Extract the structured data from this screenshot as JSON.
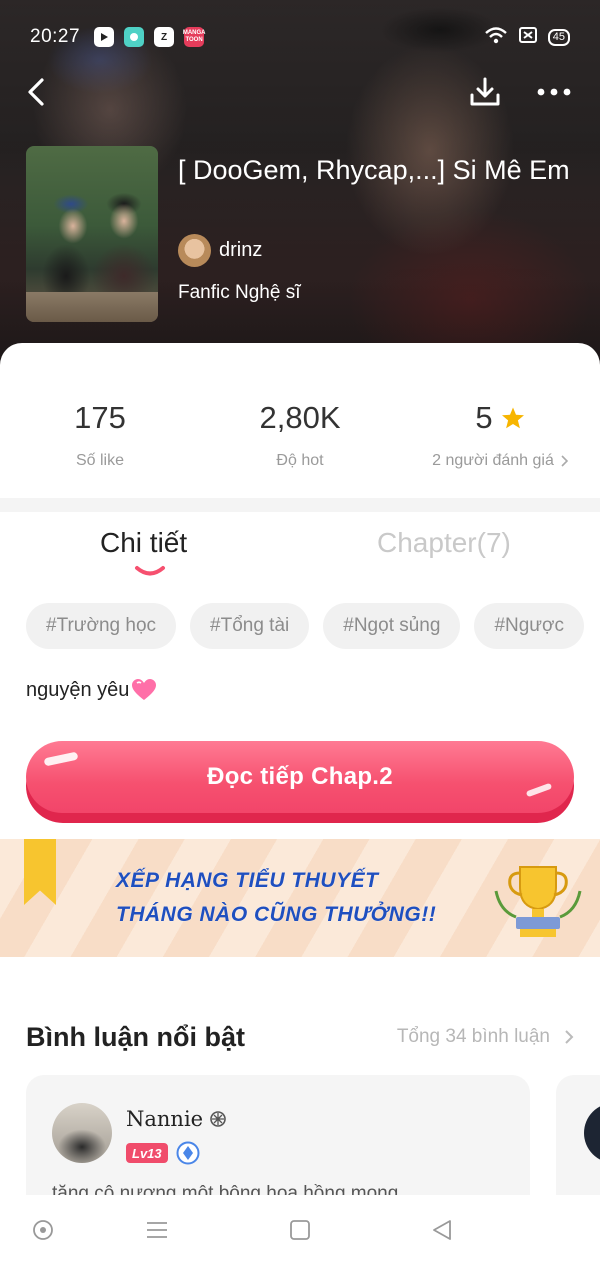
{
  "status_bar": {
    "time": "20:27",
    "apps": [
      "video-app",
      "chat-app",
      "zalo-app",
      "mangatoon-app"
    ],
    "manga_label": "MANGA TOON",
    "zalo_label": "Z",
    "battery": "45"
  },
  "header": {
    "back_icon": "chevron-left-icon",
    "download_icon": "download-icon",
    "more_icon": "more-dots-icon"
  },
  "book": {
    "title": "[ DooGem, Rhycap,...] Si Mê Em",
    "author": "drinz",
    "genre": "Fanfic Nghệ sĩ"
  },
  "stats": {
    "likes_value": "175",
    "likes_label": "Số like",
    "hot_value": "2,80K",
    "hot_label": "Độ hot",
    "rating_value": "5",
    "rating_label": "2 người đánh giá"
  },
  "tabs": {
    "details": "Chi tiết",
    "chapters": "Chapter(7)"
  },
  "tags": [
    "#Trường học",
    "#Tổng tài",
    "#Ngọt sủng",
    "#Ngược"
  ],
  "description": "nguyện yêu",
  "read_button": "Đọc tiếp Chap.2",
  "banner": {
    "line1": "XẾP HẠNG TIỂU THUYẾT",
    "line2": "THÁNG NÀO CŨNG THƯỞNG!!"
  },
  "comments": {
    "title": "Bình luận nổi bật",
    "total": "Tổng 34 bình luận",
    "items": [
      {
        "user": "Nannie",
        "level": "Lv13",
        "text": "tặng cô nương một bông hoa hồng mong"
      }
    ]
  },
  "colors": {
    "accent_pink": "#f6506f",
    "star": "#f7b500",
    "banner_text": "#1f4fbf"
  }
}
